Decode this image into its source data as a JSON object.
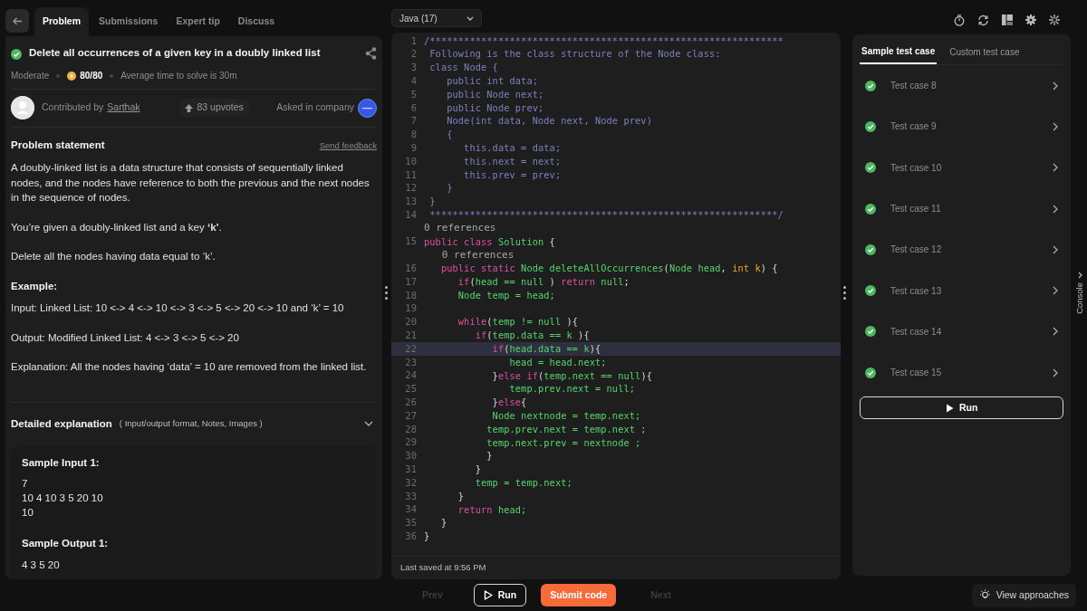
{
  "nav": {
    "tabs": [
      {
        "label": "Problem",
        "selected": true
      },
      {
        "label": "Submissions",
        "selected": false
      },
      {
        "label": "Expert tip",
        "selected": false
      },
      {
        "label": "Discuss",
        "selected": false
      }
    ]
  },
  "problem": {
    "title": "Delete all occurrences of a given key in a doubly linked list",
    "solved": true,
    "difficulty": "Moderate",
    "score": "80/80",
    "avg_time": "Average time to solve is 30m",
    "contributor_prefix": "Contributed by",
    "contributor": "Sarthak",
    "upvotes": "83 upvotes",
    "asked_label": "Asked in company"
  },
  "statement": {
    "heading": "Problem statement",
    "feedback_link": "Send feedback",
    "paragraphs": [
      {
        "kind": "text",
        "text": "A doubly-linked list is a data structure that consists of sequentially linked nodes, and the nodes have reference to both the previous and the next nodes in the sequence of nodes."
      },
      {
        "kind": "text",
        "text": "You’re given a doubly-linked list and a key **‘k’**."
      },
      {
        "kind": "text",
        "text": "Delete all the nodes having data equal to ‘k’."
      },
      {
        "kind": "heading",
        "text": "Example:"
      },
      {
        "kind": "line",
        "text": "Input: Linked List: 10 <-> 4 <-> 10 <-> 3 <-> 5 <-> 20 <-> 10 and ‘k’ = 10"
      },
      {
        "kind": "text",
        "text": "Output: Modified Linked List: 4 <-> 3 <-> 5 <-> 20"
      },
      {
        "kind": "text",
        "text": "Explanation: All the nodes having ‘data’ = 10 are removed from the linked list."
      }
    ]
  },
  "explanation": {
    "title": "Detailed explanation",
    "note": "( Input/output format, Notes, Images )"
  },
  "samples": [
    {
      "heading": "Sample Input 1:",
      "lines": [
        "7",
        "10 4 10 3 5 20 10",
        "10"
      ]
    },
    {
      "heading": "Sample Output 1:",
      "lines": [
        "4 3 5 20"
      ]
    }
  ],
  "editor": {
    "language": "Java (17)",
    "last_saved": "Last saved at 9:56 PM",
    "lines": [
      {
        "kind": "code",
        "n": "1",
        "highlighted": false,
        "tokens": [
          {
            "text": "/**************************************************************",
            "kind": "comment"
          }
        ]
      },
      {
        "kind": "code",
        "n": "2",
        "highlighted": false,
        "tokens": [
          {
            "text": " Following is the class structure of the Node class:",
            "kind": "comment"
          }
        ]
      },
      {
        "kind": "code",
        "n": "3",
        "highlighted": false,
        "tokens": [
          {
            "text": " class Node {",
            "kind": "comment"
          }
        ]
      },
      {
        "kind": "code",
        "n": "4",
        "highlighted": false,
        "tokens": [
          {
            "text": "    public int data;",
            "kind": "comment"
          }
        ]
      },
      {
        "kind": "code",
        "n": "5",
        "highlighted": false,
        "tokens": [
          {
            "text": "    public Node next;",
            "kind": "comment"
          }
        ]
      },
      {
        "kind": "code",
        "n": "6",
        "highlighted": false,
        "tokens": [
          {
            "text": "    public Node prev;",
            "kind": "comment"
          }
        ]
      },
      {
        "kind": "code",
        "n": "7",
        "highlighted": false,
        "tokens": [
          {
            "text": "    Node(int data, Node next, Node prev)",
            "kind": "comment"
          }
        ]
      },
      {
        "kind": "code",
        "n": "8",
        "highlighted": false,
        "tokens": [
          {
            "text": "    {",
            "kind": "comment"
          }
        ]
      },
      {
        "kind": "code",
        "n": "9",
        "highlighted": false,
        "tokens": [
          {
            "text": "       this.data = data;",
            "kind": "comment"
          }
        ]
      },
      {
        "kind": "code",
        "n": "10",
        "highlighted": false,
        "tokens": [
          {
            "text": "       this.next = next;",
            "kind": "comment"
          }
        ]
      },
      {
        "kind": "code",
        "n": "11",
        "highlighted": false,
        "tokens": [
          {
            "text": "       this.prev = prev;",
            "kind": "comment"
          }
        ]
      },
      {
        "kind": "code",
        "n": "12",
        "highlighted": false,
        "tokens": [
          {
            "text": "    }",
            "kind": "comment"
          }
        ]
      },
      {
        "kind": "code",
        "n": "13",
        "highlighted": false,
        "tokens": [
          {
            "text": " }",
            "kind": "comment"
          }
        ]
      },
      {
        "kind": "code",
        "n": "14",
        "highlighted": false,
        "tokens": [
          {
            "text": " *************************************************************/",
            "kind": "comment"
          }
        ]
      },
      {
        "kind": "lens",
        "text": "0 references"
      },
      {
        "kind": "code",
        "n": "15",
        "highlighted": false,
        "tokens": [
          {
            "text": "public class",
            "kind": "keyword"
          },
          {
            "text": " Solution",
            "kind": "type"
          },
          {
            "text": " {",
            "kind": "plain"
          }
        ]
      },
      {
        "kind": "lens",
        "text": "   0 references"
      },
      {
        "kind": "code",
        "n": "16",
        "highlighted": false,
        "tokens": [
          {
            "text": "   public static ",
            "kind": "keyword"
          },
          {
            "text": "Node deleteAllOccurrences",
            "kind": "type"
          },
          {
            "text": "(",
            "kind": "plain"
          },
          {
            "text": "Node head",
            "kind": "type"
          },
          {
            "text": ", ",
            "kind": "plain"
          },
          {
            "text": "int k",
            "kind": "param"
          },
          {
            "text": ") {",
            "kind": "plain"
          }
        ]
      },
      {
        "kind": "code",
        "n": "17",
        "highlighted": false,
        "tokens": [
          {
            "text": "      if",
            "kind": "keyword"
          },
          {
            "text": "(",
            "kind": "plain"
          },
          {
            "text": "head == null",
            "kind": "type"
          },
          {
            "text": " ) ",
            "kind": "plain"
          },
          {
            "text": "return ",
            "kind": "keyword"
          },
          {
            "text": "null",
            "kind": "type"
          },
          {
            "text": ";",
            "kind": "plain"
          }
        ]
      },
      {
        "kind": "code",
        "n": "18",
        "highlighted": false,
        "tokens": [
          {
            "text": "      Node temp = head;",
            "kind": "type"
          }
        ]
      },
      {
        "kind": "code",
        "n": "19",
        "highlighted": false
      },
      {
        "kind": "code",
        "n": "20",
        "highlighted": false,
        "tokens": [
          {
            "text": "      while",
            "kind": "keyword"
          },
          {
            "text": "(",
            "kind": "plain"
          },
          {
            "text": "temp != null",
            "kind": "type"
          },
          {
            "text": " ){",
            "kind": "plain"
          }
        ]
      },
      {
        "kind": "code",
        "n": "21",
        "highlighted": false,
        "tokens": [
          {
            "text": "         if",
            "kind": "keyword"
          },
          {
            "text": "(",
            "kind": "plain"
          },
          {
            "text": "temp.data == k",
            "kind": "type"
          },
          {
            "text": " ){",
            "kind": "plain"
          }
        ]
      },
      {
        "kind": "code",
        "n": "22",
        "highlighted": true,
        "tokens": [
          {
            "text": "            if",
            "kind": "keyword"
          },
          {
            "text": "(",
            "kind": "plain"
          },
          {
            "text": "head.data == k",
            "kind": "type"
          },
          {
            "text": "){",
            "kind": "plain"
          }
        ]
      },
      {
        "kind": "code",
        "n": "23",
        "highlighted": false,
        "tokens": [
          {
            "text": "               head = head.next;",
            "kind": "type"
          }
        ]
      },
      {
        "kind": "code",
        "n": "24",
        "highlighted": false,
        "tokens": [
          {
            "text": "            }",
            "kind": "plain"
          },
          {
            "text": "else if",
            "kind": "keyword"
          },
          {
            "text": "(",
            "kind": "plain"
          },
          {
            "text": "temp.next == null",
            "kind": "type"
          },
          {
            "text": "){",
            "kind": "plain"
          }
        ]
      },
      {
        "kind": "code",
        "n": "25",
        "highlighted": false,
        "tokens": [
          {
            "text": "               temp.prev.next = null;",
            "kind": "type"
          }
        ]
      },
      {
        "kind": "code",
        "n": "26",
        "highlighted": false,
        "tokens": [
          {
            "text": "            }",
            "kind": "plain"
          },
          {
            "text": "else",
            "kind": "keyword"
          },
          {
            "text": "{",
            "kind": "plain"
          }
        ]
      },
      {
        "kind": "code",
        "n": "27",
        "highlighted": false,
        "tokens": [
          {
            "text": "            Node nextnode = temp.next;",
            "kind": "type"
          }
        ]
      },
      {
        "kind": "code",
        "n": "28",
        "highlighted": false,
        "tokens": [
          {
            "text": "           temp.prev.next = temp.next ;",
            "kind": "type"
          }
        ]
      },
      {
        "kind": "code",
        "n": "29",
        "highlighted": false,
        "tokens": [
          {
            "text": "           temp.next.prev = nextnode ;",
            "kind": "type"
          }
        ]
      },
      {
        "kind": "code",
        "n": "30",
        "highlighted": false,
        "tokens": [
          {
            "text": "           }",
            "kind": "plain"
          }
        ]
      },
      {
        "kind": "code",
        "n": "31",
        "highlighted": false,
        "tokens": [
          {
            "text": "         }",
            "kind": "plain"
          }
        ]
      },
      {
        "kind": "code",
        "n": "32",
        "highlighted": false,
        "tokens": [
          {
            "text": "         temp = temp.next;",
            "kind": "type"
          }
        ]
      },
      {
        "kind": "code",
        "n": "33",
        "highlighted": false,
        "tokens": [
          {
            "text": "      }",
            "kind": "plain"
          }
        ]
      },
      {
        "kind": "code",
        "n": "34",
        "highlighted": false,
        "tokens": [
          {
            "text": "      return",
            "kind": "keyword"
          },
          {
            "text": " head;",
            "kind": "type"
          }
        ]
      },
      {
        "kind": "code",
        "n": "35",
        "highlighted": false,
        "tokens": [
          {
            "text": "   }",
            "kind": "plain"
          }
        ]
      },
      {
        "kind": "code",
        "n": "36",
        "highlighted": false,
        "tokens": [
          {
            "text": "}",
            "kind": "plain"
          }
        ]
      }
    ]
  },
  "tests": {
    "tabs": [
      {
        "label": "Sample test case",
        "selected": true
      },
      {
        "label": "Custom test case",
        "selected": false
      }
    ],
    "cases": [
      {
        "label": "Test case 8",
        "passed": true
      },
      {
        "label": "Test case 9",
        "passed": true
      },
      {
        "label": "Test case 10",
        "passed": true
      },
      {
        "label": "Test case 11",
        "passed": true
      },
      {
        "label": "Test case 12",
        "passed": true
      },
      {
        "label": "Test case 13",
        "passed": true
      },
      {
        "label": "Test case 14",
        "passed": true
      },
      {
        "label": "Test case 15",
        "passed": true
      }
    ],
    "run_label": "Run"
  },
  "console_label": "Console",
  "footer": {
    "prev": {
      "label": "Prev",
      "disabled": true
    },
    "run": "Run",
    "submit": "Submit code",
    "next": {
      "label": "Next",
      "disabled": true
    },
    "approaches": "View approaches"
  }
}
